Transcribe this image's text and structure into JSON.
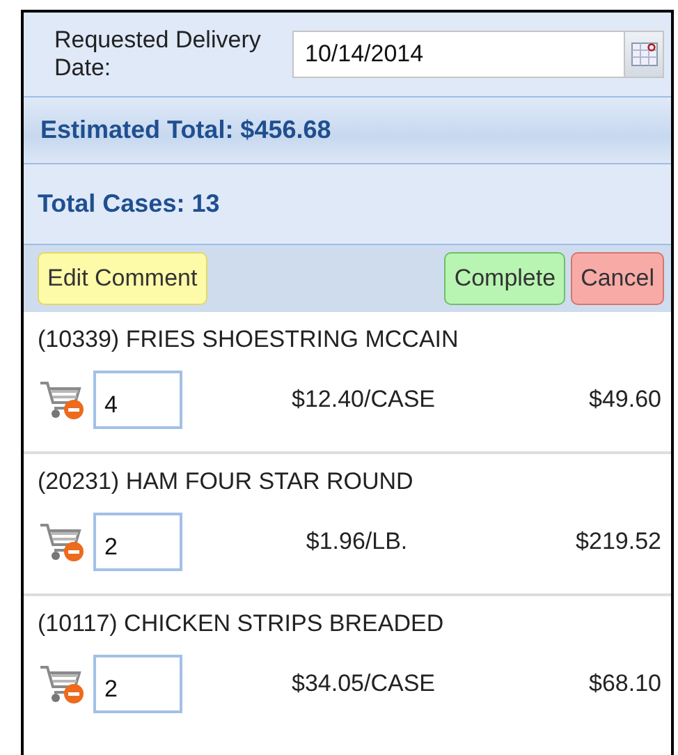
{
  "delivery_date": {
    "label": "Requested Delivery Date:",
    "value": "10/14/2014"
  },
  "estimated_total": "Estimated Total: $456.68",
  "total_cases": "Total Cases: 13",
  "buttons": [
    {
      "label": "Edit Comment",
      "kind": "comment"
    },
    {
      "label": "Complete",
      "kind": "complete"
    },
    {
      "label": "Cancel",
      "kind": "cancel"
    }
  ],
  "items": [
    {
      "name": "(10339) FRIES SHOESTRING MCCAIN",
      "quantity": "4",
      "unit_price": "$12.40/CASE",
      "total": "$49.60"
    },
    {
      "name": "(20231) HAM FOUR STAR ROUND",
      "quantity": "2",
      "unit_price": "$1.96/LB.",
      "total": "$219.52"
    },
    {
      "name": "(10117) CHICKEN STRIPS BREADED",
      "quantity": "2",
      "unit_price": "$34.05/CASE",
      "total": "$68.10"
    }
  ]
}
